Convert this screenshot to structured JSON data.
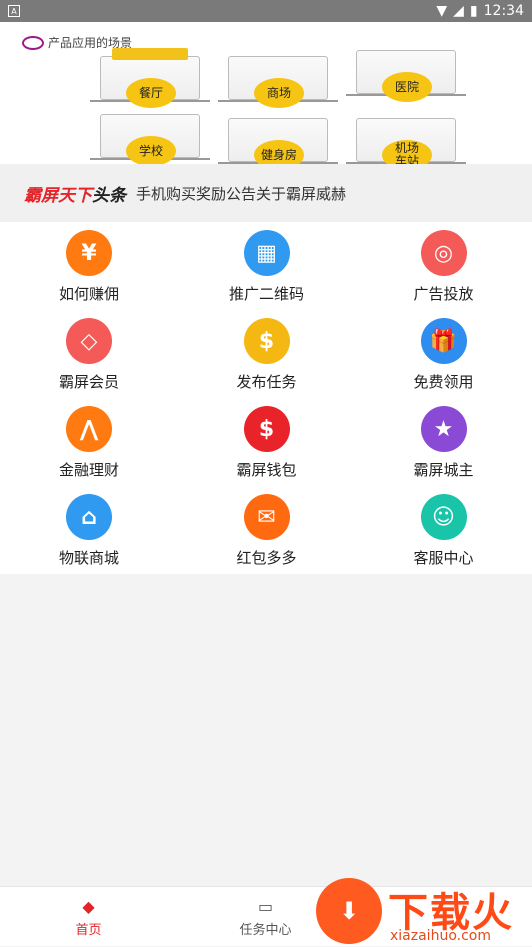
{
  "status_bar": {
    "time": "12:34"
  },
  "banner": {
    "caption": "产品应用的场景",
    "scenes": [
      "餐厅",
      "商场",
      "医院",
      "学校",
      "健身房",
      "机场\n车站"
    ]
  },
  "headline": {
    "brand_part1": "霸屏天下",
    "brand_part2": "头条",
    "text": "手机购买奖励公告关于霸屏威赫"
  },
  "grid": [
    {
      "label": "如何赚佣",
      "icon": "yen-hand-icon",
      "color": "#ff7a10",
      "glyph": "¥"
    },
    {
      "label": "推广二维码",
      "icon": "qrcode-icon",
      "color": "#2f9af0",
      "glyph": "▦"
    },
    {
      "label": "广告投放",
      "icon": "target-icon",
      "color": "#f45a58",
      "glyph": "◎"
    },
    {
      "label": "霸屏会员",
      "icon": "diamond-icon",
      "color": "#f45a58",
      "glyph": "◇"
    },
    {
      "label": "发布任务",
      "icon": "coins-icon",
      "color": "#f5b712",
      "glyph": "$"
    },
    {
      "label": "免费领用",
      "icon": "gift-icon",
      "color": "#2f8df0",
      "glyph": "🎁"
    },
    {
      "label": "金融理财",
      "icon": "mountain-icon",
      "color": "#ff7a10",
      "glyph": "⋀"
    },
    {
      "label": "霸屏钱包",
      "icon": "piggy-bank-icon",
      "color": "#e8242a",
      "glyph": "$"
    },
    {
      "label": "霸屏城主",
      "icon": "star-icon",
      "color": "#8a4ad6",
      "glyph": "★"
    },
    {
      "label": "物联商城",
      "icon": "store-icon",
      "color": "#2f9af0",
      "glyph": "⌂"
    },
    {
      "label": "红包多多",
      "icon": "red-envelope-icon",
      "color": "#ff6a10",
      "glyph": "✉"
    },
    {
      "label": "客服中心",
      "icon": "headset-icon",
      "color": "#19c4a8",
      "glyph": "☺"
    }
  ],
  "tabbar": {
    "home": "首页",
    "tasks": "任务中心"
  },
  "watermark": {
    "title": "下载火",
    "url": "xiazaihuo.com"
  },
  "colors": {
    "accent": "#e32428"
  }
}
